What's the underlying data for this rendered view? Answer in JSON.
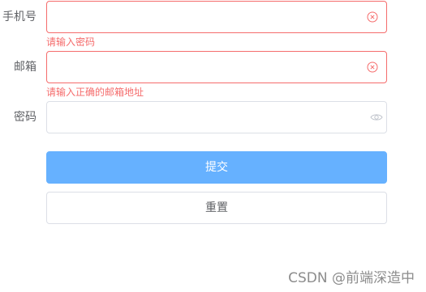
{
  "form": {
    "phone": {
      "label": "手机号",
      "value": "",
      "error": "请输入密码"
    },
    "email": {
      "label": "邮箱",
      "value": "",
      "error": "请输入正确的邮箱地址"
    },
    "password": {
      "label": "密码",
      "value": ""
    }
  },
  "buttons": {
    "submit_label": "提交",
    "reset_label": "重置"
  },
  "watermark": "CSDN @前端深造中",
  "colors": {
    "error": "#f56c6c",
    "primary_light": "#66b1ff",
    "border": "#dcdfe6",
    "label": "#606266",
    "icon": "#c0c4cc"
  },
  "icons": {
    "clear": "circle-close-icon",
    "password_toggle": "eye-icon"
  }
}
